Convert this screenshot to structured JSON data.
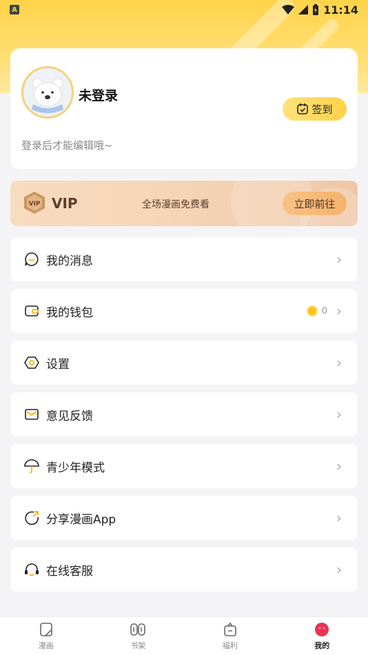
{
  "status_bar": {
    "indicator": "A",
    "time": "11:14"
  },
  "profile": {
    "name": "未登录",
    "hint": "登录后才能编辑哦~",
    "signin_label": "签到"
  },
  "vip": {
    "badge_text": "VIP",
    "label": "VIP",
    "description": "全场漫画免费看",
    "action_label": "立即前往"
  },
  "menu": {
    "items": [
      {
        "label": "我的消息",
        "icon": "message-icon"
      },
      {
        "label": "我的钱包",
        "icon": "wallet-icon",
        "value": "0"
      },
      {
        "label": "设置",
        "icon": "settings-icon"
      },
      {
        "label": "意见反馈",
        "icon": "mail-icon"
      },
      {
        "label": "青少年模式",
        "icon": "umbrella-icon"
      },
      {
        "label": "分享漫画App",
        "icon": "share-icon"
      },
      {
        "label": "在线客服",
        "icon": "headset-icon"
      }
    ]
  },
  "tabbar": {
    "tabs": [
      {
        "label": "漫画",
        "icon": "comic-icon"
      },
      {
        "label": "书架",
        "icon": "bookshelf-icon"
      },
      {
        "label": "福利",
        "icon": "gift-icon"
      },
      {
        "label": "我的",
        "icon": "profile-icon",
        "active": true
      }
    ]
  },
  "colors": {
    "accent": "#ffd44a",
    "vip_bg": "#f4d4b6",
    "active_tab": "#ee3355"
  }
}
